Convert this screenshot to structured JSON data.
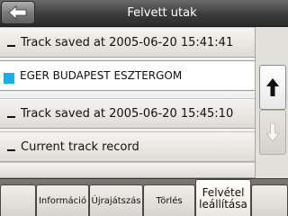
{
  "titlebar": {
    "title": "Felvett utak",
    "back_icon": "back-arrow-icon"
  },
  "list": {
    "items": [
      {
        "label": "Track saved at 2005-06-20 15:41:41",
        "selected": false
      },
      {
        "label": "EGER BUDAPEST ESZTERGOM",
        "selected": true,
        "color": "#1aaee8"
      },
      {
        "label": "Track saved at 2005-06-20 15:45:10",
        "selected": false
      },
      {
        "label": "Current track record",
        "selected": false
      }
    ]
  },
  "scrollbar": {
    "up_icon": "arrow-up-icon",
    "down_icon": "arrow-down-icon"
  },
  "toolbar": {
    "tabs": [
      {
        "label": ""
      },
      {
        "label": "Információ"
      },
      {
        "label": "Újrajátszás"
      },
      {
        "label": "Törlés"
      },
      {
        "label": "Felvétel leállítása",
        "active": true
      },
      {
        "label": ""
      }
    ]
  },
  "colors": {
    "titlebar": "#3c3c3c",
    "selected_track": "#1aaee8",
    "background": "#eceae4"
  }
}
